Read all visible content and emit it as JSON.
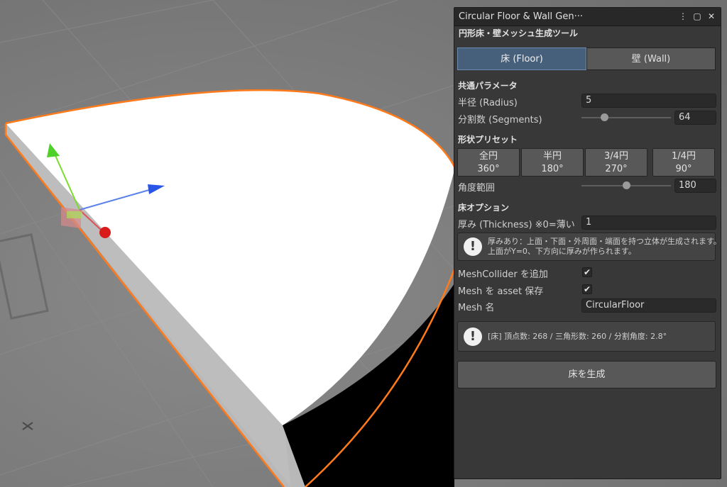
{
  "window": {
    "title": "Circular Floor & Wall Gen···",
    "subtitle": "円形床・壁メッシュ生成ツール",
    "icons": [
      "more-icon",
      "maximize-icon",
      "close-icon"
    ]
  },
  "tabs": [
    {
      "label": "床 (Floor)",
      "active": true
    },
    {
      "label": "壁 (Wall)",
      "active": false
    }
  ],
  "common": {
    "heading": "共通パラメータ",
    "radius_label": "半径 (Radius)",
    "radius_value": "5",
    "segments_label": "分割数 (Segments)",
    "segments_value": "64"
  },
  "presets": {
    "heading": "形状プリセット",
    "buttons": [
      {
        "name": "全円",
        "angle": "360°"
      },
      {
        "name": "半円",
        "angle": "180°"
      },
      {
        "name": "3/4円",
        "angle": "270°"
      },
      {
        "name": "1/4円",
        "angle": "90°"
      }
    ],
    "angle_label": "角度範囲",
    "angle_value": "180"
  },
  "floor_options": {
    "heading": "床オプション",
    "thickness_label": "厚み (Thickness) ※0=薄い",
    "thickness_value": "1",
    "help_line1": "厚みあり：上面・下面・外周面・端面を持つ立体が生成されます。",
    "help_line2": "上面がY=0、下方向に厚みが作られます。",
    "collider_label": "MeshCollider を追加",
    "collider_checked": true,
    "save_label": "Mesh を asset 保存",
    "save_checked": true,
    "mesh_name_label": "Mesh 名",
    "mesh_name_value": "CircularFloor"
  },
  "stats": {
    "text": "[床] 頂点数: 268  /  三角形数: 260  /  分割角度: 2.8°"
  },
  "generate_label": "床を生成",
  "colors": {
    "panel_bg": "#383838",
    "active_tab": "#46607c",
    "selection_outline": "#ff7a1a",
    "gizmo_y": "#7cdc2e",
    "gizmo_z": "#2a56e8",
    "gizmo_x": "#e02020"
  }
}
